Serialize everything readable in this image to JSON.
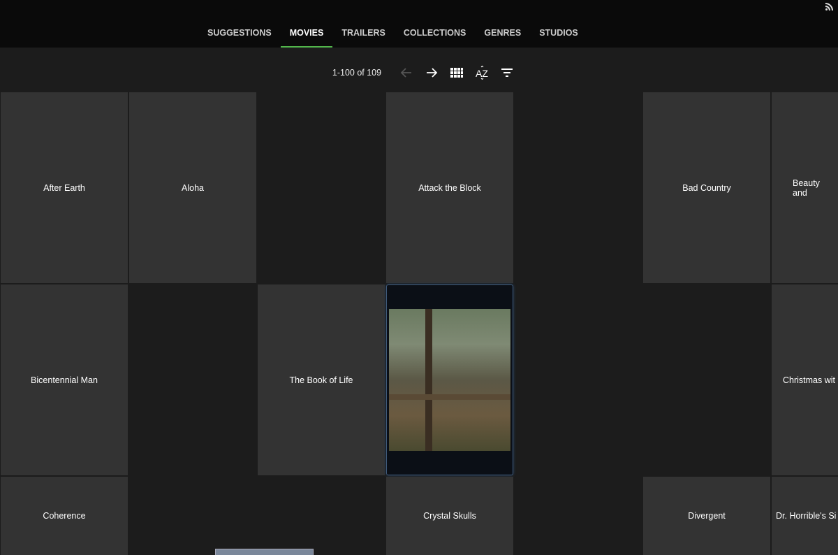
{
  "tabs": [
    "SUGGESTIONS",
    "MOVIES",
    "TRAILERS",
    "COLLECTIONS",
    "GENRES",
    "STUDIOS"
  ],
  "active_tab": "MOVIES",
  "accent": "#52b54b",
  "toolbar": {
    "count": "1-100 of 109",
    "prev_icon": "arrow-left-icon",
    "next_icon": "arrow-right-icon",
    "view_icon": "grid-icon",
    "sort_icon": "sort-az-icon",
    "filter_icon": "filter-icon"
  },
  "tiles": [
    {
      "title": "After Earth"
    },
    {
      "title": "Aloha"
    },
    {
      "title": "Attack the Block"
    },
    {
      "title": "Bad Country"
    },
    {
      "title": "Beauty and"
    },
    {
      "title": "Bicentennial Man"
    },
    {
      "title": "The Book of Life"
    },
    {
      "title": "Christmas wit"
    },
    {
      "title": "Coherence"
    },
    {
      "title": "Crystal Skulls"
    },
    {
      "title": "Divergent"
    },
    {
      "title": "Dr. Horrible's Si"
    }
  ]
}
